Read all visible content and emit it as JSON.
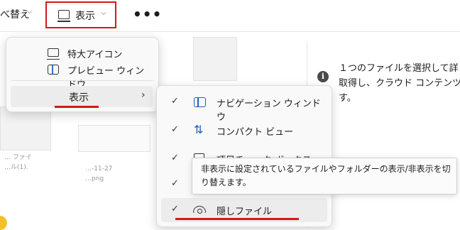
{
  "toolbar": {
    "sort_label": "べ替え",
    "view_label": "表示",
    "more_label": "•••"
  },
  "view_menu": {
    "items": [
      {
        "label": "特大アイコン",
        "icon": "monitor-icon"
      },
      {
        "label": "プレビュー ウィンドウ",
        "icon": "preview-pane-icon"
      }
    ],
    "show_label": "表示"
  },
  "show_submenu": {
    "items": [
      {
        "label": "ナビゲーション ウィンドウ",
        "checked": true,
        "icon": "navigation-pane-icon"
      },
      {
        "label": "コンパクト ビュー",
        "checked": true,
        "icon": "compact-view-icon"
      },
      {
        "label": "項目チェック ボックス",
        "checked": true,
        "icon": "item-checkbox-icon"
      },
      {
        "label": "",
        "checked": true,
        "icon": ""
      },
      {
        "label": "隠しファイル",
        "checked": true,
        "icon": "eye-icon"
      }
    ]
  },
  "tooltip": {
    "text": "非表示に設定されているファイルやフォルダーの表示/非表示を切\nり替えます。"
  },
  "details": {
    "text": "１つのファイルを選択して詳\n取得し、クラウド コンテンツを\nす。"
  },
  "files": {
    "names": [
      "… ファイ",
      "…ル(1).",
      "…",
      "…-11-27",
      "…png"
    ]
  },
  "colors": {
    "highlight_red": "#d11a1a",
    "accent_blue": "#1d5fbf"
  }
}
